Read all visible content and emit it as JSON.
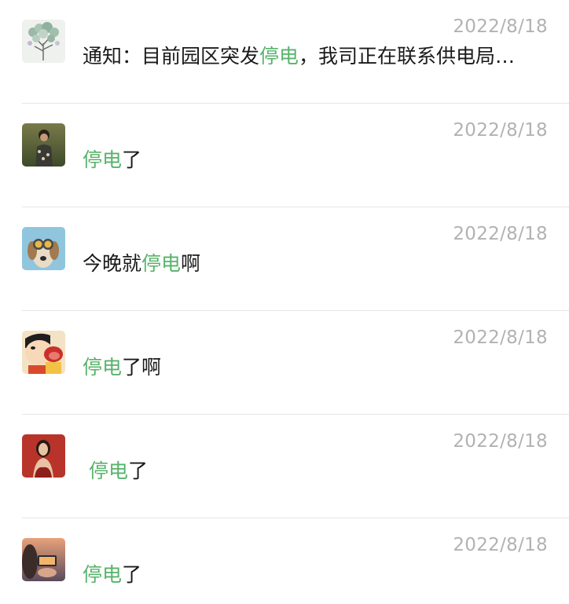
{
  "results": [
    {
      "avatar": "tree-avatar",
      "date": "2022/8/18",
      "prefix": "通知：目前园区突发",
      "highlight": "停电",
      "suffix": "，我司正在联系供电局…"
    },
    {
      "avatar": "child-photo-avatar",
      "date": "2022/8/18",
      "prefix": "",
      "highlight": "停电",
      "suffix": "了"
    },
    {
      "avatar": "dog-goggles-avatar",
      "date": "2022/8/18",
      "prefix": "今晚就",
      "highlight": "停电",
      "suffix": "啊"
    },
    {
      "avatar": "cartoon-boy-avatar",
      "date": "2022/8/18",
      "prefix": "",
      "highlight": "停电",
      "suffix": "了啊"
    },
    {
      "avatar": "woman-red-avatar",
      "date": "2022/8/18",
      "prefix": " ",
      "highlight": "停电",
      "suffix": "了"
    },
    {
      "avatar": "phone-sunset-avatar",
      "date": "2022/8/18",
      "prefix": "",
      "highlight": "停电",
      "suffix": "了"
    }
  ],
  "colors": {
    "highlight": "#57b36a",
    "date": "#b2b2b2",
    "text": "#1a1a1a",
    "divider": "#e6e6e6"
  }
}
